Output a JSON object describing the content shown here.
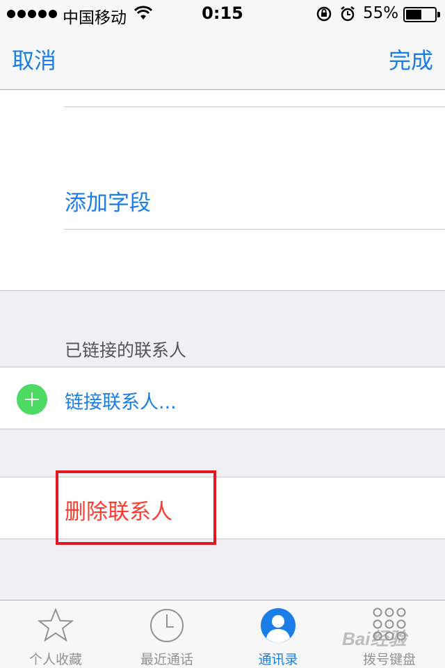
{
  "status_bar": {
    "carrier": "中国移动",
    "time": "0:15",
    "battery_percent": "55%",
    "battery_level": 0.55,
    "icons": [
      "signal-dots",
      "wifi-icon",
      "rotation-lock-icon",
      "alarm-icon",
      "battery-icon"
    ]
  },
  "nav": {
    "cancel_label": "取消",
    "done_label": "完成"
  },
  "form": {
    "add_field_label": "添加字段",
    "linked_header": "已链接的联系人",
    "link_contact_label": "链接联系人...",
    "delete_contact_label": "删除联系人"
  },
  "colors": {
    "accent": "#1a7ee6",
    "destructive": "#ff3b30",
    "add_icon": "#4cd964",
    "highlight_box": "#e0191e"
  },
  "tab_bar": {
    "tabs": [
      {
        "label": "个人收藏",
        "icon": "star-icon",
        "active": false
      },
      {
        "label": "最近通话",
        "icon": "clock-icon",
        "active": false
      },
      {
        "label": "通讯录",
        "icon": "contacts-icon",
        "active": true
      },
      {
        "label": "拨号键盘",
        "icon": "keypad-icon",
        "active": false
      }
    ]
  },
  "watermark": "Bai经验"
}
